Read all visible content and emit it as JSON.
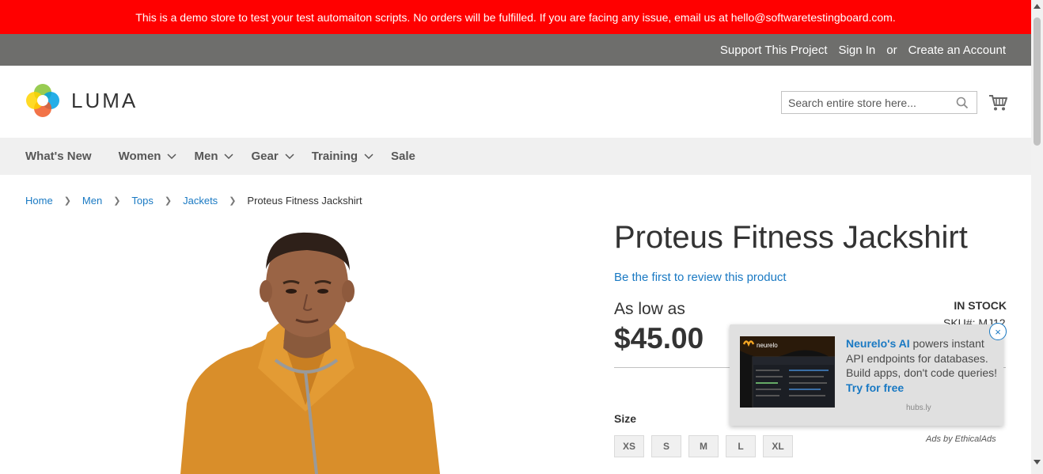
{
  "banner": {
    "text": "This is a demo store to test your test automaiton scripts. No orders will be fulfilled. If you are facing any issue, email us at hello@softwaretestingboard.com."
  },
  "header_links": {
    "support": "Support This Project",
    "sign_in": "Sign In",
    "or": "or",
    "create_account": "Create an Account"
  },
  "brand": {
    "name": "LUMA"
  },
  "search": {
    "placeholder": "Search entire store here..."
  },
  "nav": {
    "items": [
      {
        "label": "What's New",
        "has_menu": false
      },
      {
        "label": "Women",
        "has_menu": true
      },
      {
        "label": "Men",
        "has_menu": true
      },
      {
        "label": "Gear",
        "has_menu": true
      },
      {
        "label": "Training",
        "has_menu": true
      },
      {
        "label": "Sale",
        "has_menu": false
      }
    ]
  },
  "breadcrumb": {
    "items": [
      "Home",
      "Men",
      "Tops",
      "Jackets"
    ],
    "current": "Proteus Fitness Jackshirt"
  },
  "product": {
    "title": "Proteus Fitness Jackshirt",
    "review_link": "Be the first to review this product",
    "as_low_as": "As low as",
    "price": "$45.00",
    "stock": "IN STOCK",
    "sku": "SKU#:  MJ12",
    "size_label": "Size",
    "sizes": [
      "XS",
      "S",
      "M",
      "L",
      "XL"
    ]
  },
  "ad": {
    "brand": "Neurelo's AI",
    "body": " powers instant API endpoints for databases. Build apps, don't code queries! ",
    "cta": "Try for free",
    "source": "hubs.ly",
    "close": "×",
    "by": "Ads by EthicalAds"
  },
  "colors": {
    "banner": "#ff0000",
    "topbar": "#6e6e6c",
    "link": "#1979c3",
    "nav_bg": "#f0f0f0"
  }
}
